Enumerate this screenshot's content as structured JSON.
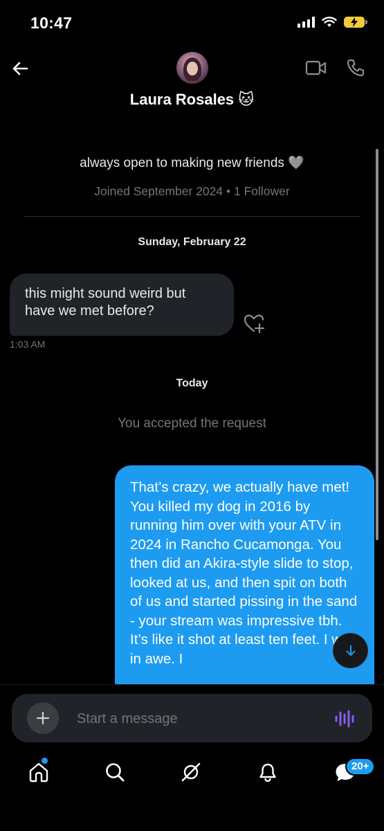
{
  "status_bar": {
    "time": "10:47"
  },
  "header": {
    "back_icon": "arrow-left-icon",
    "name": "Laura Rosales 🐱",
    "video_icon": "video-camera-icon",
    "phone_icon": "phone-icon"
  },
  "profile": {
    "bio": "always open to making new friends 🩶",
    "joined": "Joined September 2024 • 1 Follower"
  },
  "conversation": {
    "date_sections": [
      "Sunday, February 22",
      "Today"
    ],
    "incoming_message": {
      "text": "this might sound weird but have we met before?",
      "time": "1:03 AM"
    },
    "system_message": "You accepted the request",
    "outgoing_message": {
      "text": "That’s crazy, we actually have met! You killed my dog in 2016 by running him over with your ATV in 2024 in Rancho Cucamonga. You then did an Akira-style slide to stop, looked at us, and then spit on both of us and started pissing in the sand - your stream was impressive tbh. It’s like it shot at least ten feet. I was in awe. I"
    }
  },
  "composer": {
    "placeholder": "Start a message"
  },
  "tab_bar": {
    "items": [
      "home-icon",
      "search-icon",
      "grok-icon",
      "bell-icon",
      "messages-icon"
    ],
    "messages_badge": "20+"
  },
  "colors": {
    "accent": "#1d9bf0",
    "background": "#000000",
    "incoming_bubble": "#202327",
    "muted_text": "#71767b",
    "voice_purple": "#8b5cf6"
  }
}
